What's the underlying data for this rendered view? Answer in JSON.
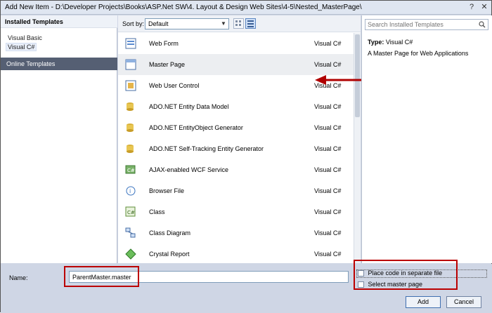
{
  "window": {
    "title": "Add New Item - D:\\Developer Projects\\Books\\ASP.Net SW\\4. Layout & Design Web Sites\\4-5\\Nested_MasterPage\\",
    "help_glyph": "?",
    "close_glyph": "✕"
  },
  "left_pane": {
    "installed_header": "Installed Templates",
    "languages": [
      "Visual Basic",
      "Visual C#"
    ],
    "online_templates": "Online Templates"
  },
  "sortbar": {
    "label": "Sort by:",
    "value": "Default"
  },
  "templates": [
    {
      "name": "Web Form",
      "lang": "Visual C#",
      "icon": "web-form-icon"
    },
    {
      "name": "Master Page",
      "lang": "Visual C#",
      "icon": "master-page-icon"
    },
    {
      "name": "Web User Control",
      "lang": "Visual C#",
      "icon": "user-control-icon"
    },
    {
      "name": "ADO.NET Entity Data Model",
      "lang": "Visual C#",
      "icon": "entity-model-icon"
    },
    {
      "name": "ADO.NET EntityObject Generator",
      "lang": "Visual C#",
      "icon": "entity-generator-icon"
    },
    {
      "name": "ADO.NET Self-Tracking Entity Generator",
      "lang": "Visual C#",
      "icon": "self-tracking-icon"
    },
    {
      "name": "AJAX-enabled WCF Service",
      "lang": "Visual C#",
      "icon": "wcf-service-icon"
    },
    {
      "name": "Browser File",
      "lang": "Visual C#",
      "icon": "browser-file-icon"
    },
    {
      "name": "Class",
      "lang": "Visual C#",
      "icon": "class-icon"
    },
    {
      "name": "Class Diagram",
      "lang": "Visual C#",
      "icon": "class-diagram-icon"
    },
    {
      "name": "Crystal Report",
      "lang": "Visual C#",
      "icon": "crystal-report-icon"
    }
  ],
  "right_pane": {
    "search_placeholder": "Search Installed Templates",
    "type_label": "Type:",
    "type_value": "Visual C#",
    "description": "A Master Page for Web Applications"
  },
  "bottom": {
    "name_label": "Name:",
    "name_value": "ParentMaster.master",
    "separate_file_label": "Place code in separate file",
    "select_master_label": "Select master page",
    "add_button": "Add",
    "cancel_button": "Cancel"
  },
  "colors": {
    "annotation_red": "#b00000",
    "selected_row": "#eceef1",
    "dialog_bg": "#cfd6e5"
  }
}
